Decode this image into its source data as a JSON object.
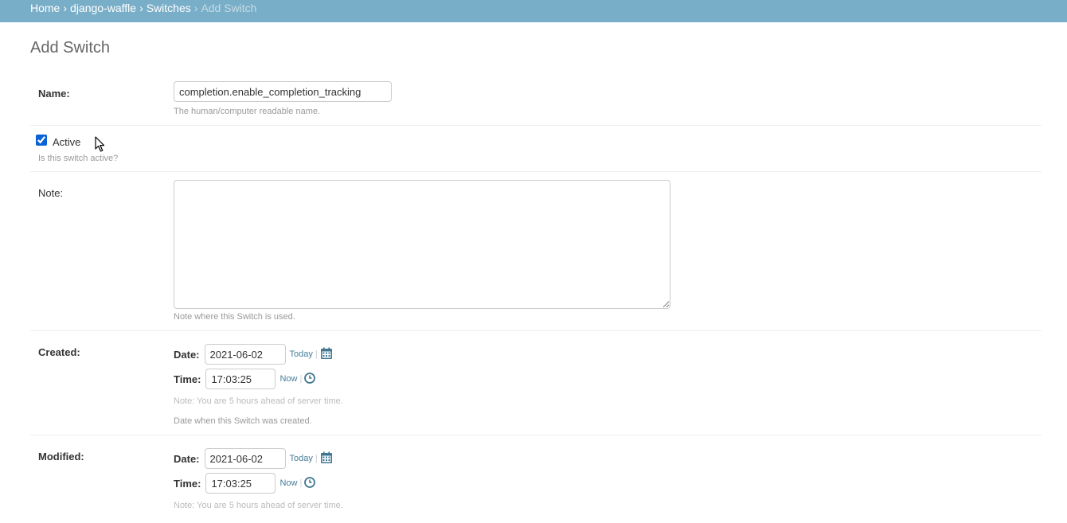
{
  "breadcrumbs": {
    "items": [
      "Home",
      "django-waffle",
      "Switches"
    ],
    "current": "Add Switch",
    "separator": "›"
  },
  "page_title": "Add Switch",
  "form": {
    "name": {
      "label": "Name:",
      "value": "completion.enable_completion_tracking",
      "help": "The human/computer readable name."
    },
    "active": {
      "label": "Active",
      "checked": true,
      "help": "Is this switch active?"
    },
    "note": {
      "label": "Note:",
      "value": "",
      "help": "Note where this Switch is used."
    },
    "created": {
      "label": "Created:",
      "date_label": "Date:",
      "date_value": "2021-06-02",
      "today_label": "Today",
      "time_label": "Time:",
      "time_value": "17:03:25",
      "now_label": "Now",
      "tz_note": "Note: You are 5 hours ahead of server time.",
      "help": "Date when this Switch was created."
    },
    "modified": {
      "label": "Modified:",
      "date_label": "Date:",
      "date_value": "2021-06-02",
      "today_label": "Today",
      "time_label": "Time:",
      "time_value": "17:03:25",
      "now_label": "Now",
      "tz_note": "Note: You are 5 hours ahead of server time."
    }
  },
  "icons": {
    "calendar": "calendar-icon",
    "clock": "clock-icon",
    "cursor": "mouse-cursor-icon"
  },
  "colors": {
    "header_bg": "#79aec8",
    "link": "#447e9b",
    "help_text": "#999999"
  }
}
